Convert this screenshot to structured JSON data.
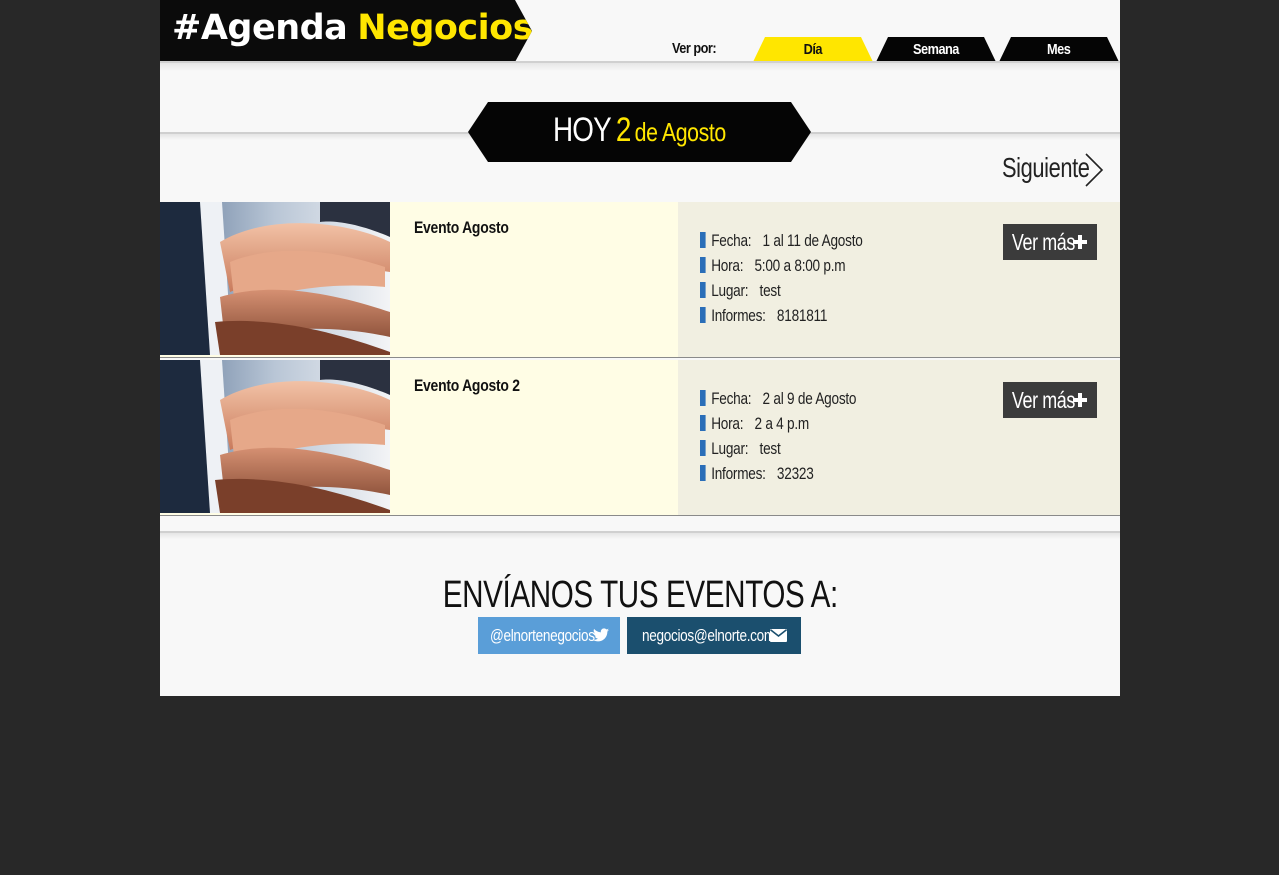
{
  "header": {
    "logo_part1": "#Agenda",
    "logo_part2": "Negocios",
    "view_by_label": "Ver por:",
    "tabs": [
      {
        "label": "Día",
        "active": true
      },
      {
        "label": "Semana",
        "active": false
      },
      {
        "label": "Mes",
        "active": false
      }
    ]
  },
  "date_banner": {
    "today_label": "HOY",
    "day": "2",
    "month_text": "de Agosto"
  },
  "navigation": {
    "next_label": "Siguiente"
  },
  "events": [
    {
      "title": "Evento Agosto",
      "fecha_label": "Fecha:",
      "fecha": "1 al 11 de Agosto",
      "hora_label": "Hora:",
      "hora": "5:00 a 8:00 p.m",
      "lugar_label": "Lugar:",
      "lugar": "test",
      "informes_label": "Informes:",
      "informes": "8181811",
      "more_label": "Ver más"
    },
    {
      "title": "Evento Agosto 2",
      "fecha_label": "Fecha:",
      "fecha": "2 al 9 de Agosto",
      "hora_label": "Hora:",
      "hora": "2 a 4 p.m",
      "lugar_label": "Lugar:",
      "lugar": "test",
      "informes_label": "Informes:",
      "informes": "32323",
      "more_label": "Ver más"
    }
  ],
  "footer": {
    "heading": "ENVÍANOS TUS EVENTOS A:",
    "twitter_label": "@elnortenegocios",
    "email_label": "negocios@elnorte.com"
  },
  "colors": {
    "accent_yellow": "#ffe600",
    "black": "#050505",
    "event_bg": "#fffde5",
    "details_bg": "#f1efe1",
    "detail_bar_blue": "#2a6eb8",
    "twitter_blue": "#5a9ed8",
    "email_navy": "#1b4f6e",
    "outer_bg": "#282828"
  },
  "icons": {
    "next": "chevron-right-icon",
    "more": "plus-icon",
    "twitter": "twitter-icon",
    "email": "envelope-icon",
    "event_image": "handshake-photo"
  }
}
